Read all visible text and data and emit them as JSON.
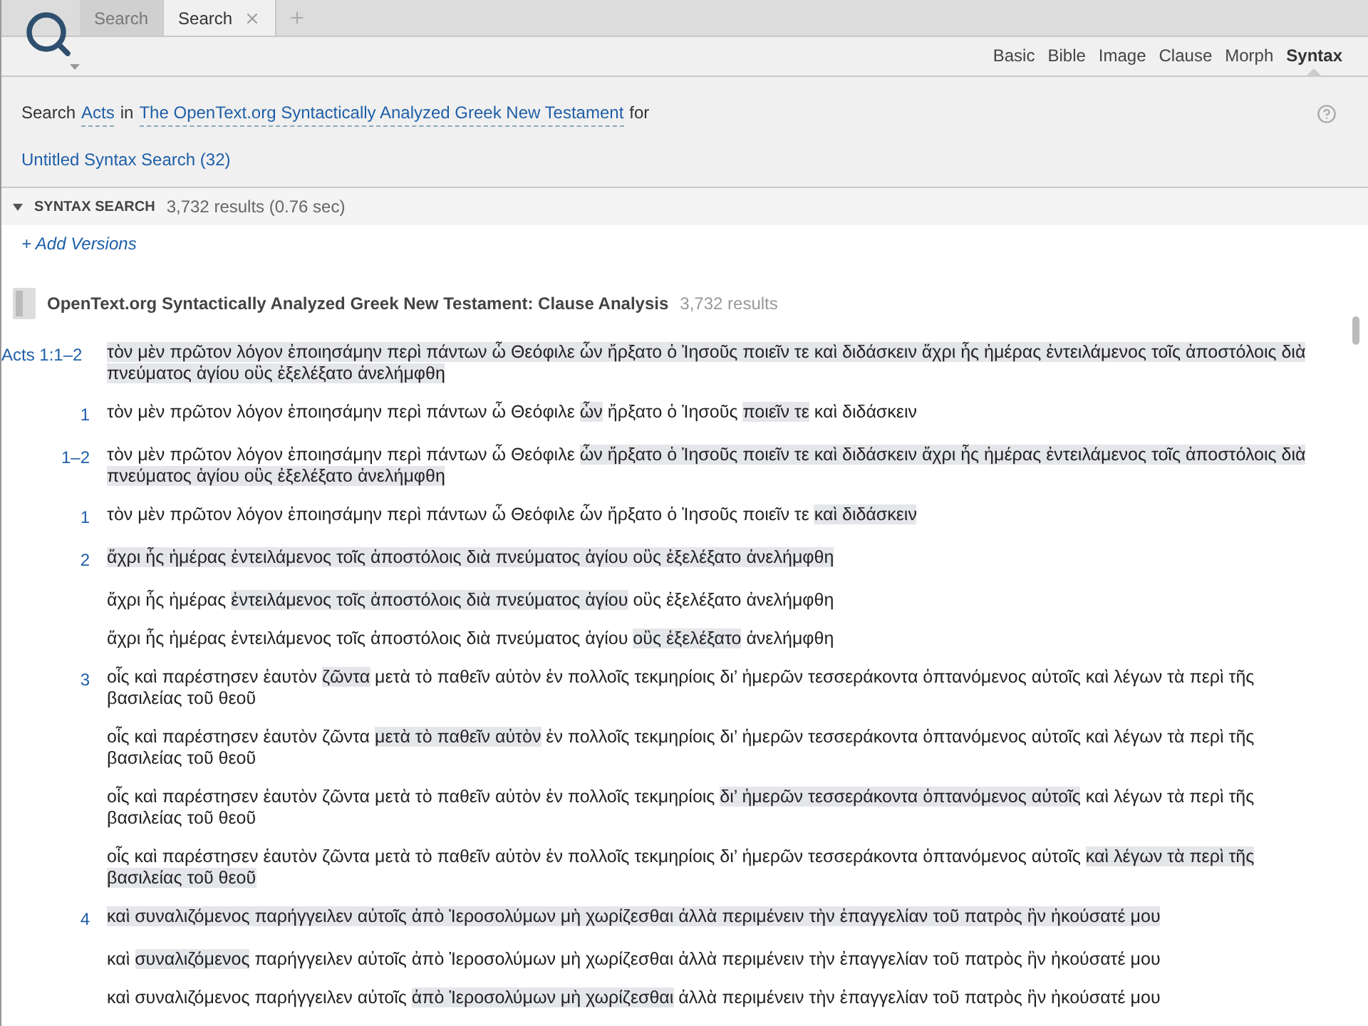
{
  "tabs": [
    {
      "label": "Search",
      "selected": false
    },
    {
      "label": "Search",
      "selected": true
    }
  ],
  "search_types": [
    {
      "label": "Basic",
      "selected": false
    },
    {
      "label": "Bible",
      "selected": false
    },
    {
      "label": "Image",
      "selected": false
    },
    {
      "label": "Clause",
      "selected": false
    },
    {
      "label": "Morph",
      "selected": false
    },
    {
      "label": "Syntax",
      "selected": true
    }
  ],
  "query": {
    "prefix": "Search",
    "range": "Acts",
    "connector": "in",
    "resource": "The OpenText.org Syntactically Analyzed Greek New Testament",
    "suffix": "for",
    "saved_search": "Untitled Syntax Search (32)"
  },
  "section": {
    "title": "SYNTAX SEARCH",
    "summary": "3,732 results (0.76 sec)",
    "expanded": true
  },
  "add_versions": "+ Add Versions",
  "results": {
    "title": "OpenText.org Syntactically Analyzed Greek New Testament: Clause Analysis",
    "count": "3,732 results",
    "rows": [
      {
        "label": "Acts 1:1–2",
        "kind": "reference",
        "segments": [
          {
            "text": "τὸν μὲν πρῶτον λόγον ἐποιησάμην περὶ πάντων ὦ Θεόφιλε ὧν ἤρξατο ὁ Ἰησοῦς ποιεῖν τε καὶ διδάσκειν ἄχρι ἧς ἡμέρας ἐντειλάμενος τοῖς ἀποστόλοις διὰ πνεύματος ἁγίου οὓς ἐξελέξατο ἀνελήμφθη",
            "highlighted": true
          }
        ]
      },
      {
        "label": "1",
        "kind": "number",
        "segments": [
          {
            "text": "τὸν μὲν πρῶτον λόγον ἐποιησάμην περὶ πάντων ὦ Θεόφιλε ",
            "highlighted": false
          },
          {
            "text": "ὧν",
            "highlighted": true
          },
          {
            "text": " ἤρξατο ὁ Ἰησοῦς ",
            "highlighted": false
          },
          {
            "text": "ποιεῖν τε",
            "highlighted": true
          },
          {
            "text": " καὶ διδάσκειν",
            "highlighted": false
          }
        ]
      },
      {
        "label": "1–2",
        "kind": "number",
        "segments": [
          {
            "text": "τὸν μὲν πρῶτον λόγον ἐποιησάμην περὶ πάντων ὦ Θεόφιλε ",
            "highlighted": false
          },
          {
            "text": "ὧν ἤρξατο ὁ Ἰησοῦς ποιεῖν τε καὶ διδάσκειν ἄχρι ἧς ἡμέρας ἐντειλάμενος τοῖς ἀποστόλοις διὰ πνεύματος ἁγίου οὓς ἐξελέξατο ἀνελήμφθη",
            "highlighted": true
          }
        ]
      },
      {
        "label": "1",
        "kind": "number",
        "segments": [
          {
            "text": "τὸν μὲν πρῶτον λόγον ἐποιησάμην περὶ πάντων ὦ Θεόφιλε ὧν ἤρξατο ὁ Ἰησοῦς ποιεῖν τε ",
            "highlighted": false
          },
          {
            "text": "καὶ διδάσκειν",
            "highlighted": true
          }
        ]
      },
      {
        "label": "2",
        "kind": "number",
        "segments": [
          {
            "text": "ἄχρι ἧς ἡμέρας ἐντειλάμενος τοῖς ἀποστόλοις διὰ πνεύματος ἁγίου οὓς ἐξελέξατο ἀνελήμφθη",
            "highlighted": true
          }
        ]
      },
      {
        "kind": "plain",
        "segments": [
          {
            "text": "ἄχρι ἧς ἡμέρας ",
            "highlighted": false
          },
          {
            "text": "ἐντειλάμενος τοῖς ἀποστόλοις διὰ πνεύματος ἁγίου",
            "highlighted": true
          },
          {
            "text": " οὓς ἐξελέξατο ἀνελήμφθη",
            "highlighted": false
          }
        ]
      },
      {
        "kind": "plain",
        "segments": [
          {
            "text": "ἄχρι ἧς ἡμέρας ἐντειλάμενος τοῖς ἀποστόλοις διὰ πνεύματος ἁγίου ",
            "highlighted": false
          },
          {
            "text": "οὓς ἐξελέξατο",
            "highlighted": true
          },
          {
            "text": " ἀνελήμφθη",
            "highlighted": false
          }
        ]
      },
      {
        "label": "3",
        "kind": "number",
        "segments": [
          {
            "text": "οἷς καὶ παρέστησεν ἑαυτὸν ",
            "highlighted": false
          },
          {
            "text": "ζῶντα",
            "highlighted": true
          },
          {
            "text": " μετὰ τὸ παθεῖν αὐτὸν ἐν πολλοῖς τεκμηρίοις δι’ ἡμερῶν τεσσεράκοντα ὀπτανόμενος αὐτοῖς καὶ λέγων τὰ περὶ τῆς βασιλείας τοῦ θεοῦ",
            "highlighted": false
          }
        ]
      },
      {
        "kind": "plain",
        "segments": [
          {
            "text": "οἷς καὶ παρέστησεν ἑαυτὸν ζῶντα ",
            "highlighted": false
          },
          {
            "text": "μετὰ τὸ παθεῖν αὐτὸν",
            "highlighted": true
          },
          {
            "text": " ἐν πολλοῖς τεκμηρίοις δι’ ἡμερῶν τεσσεράκοντα ὀπτανόμενος αὐτοῖς καὶ λέγων τὰ περὶ τῆς βασιλείας τοῦ θεοῦ",
            "highlighted": false
          }
        ]
      },
      {
        "kind": "plain",
        "segments": [
          {
            "text": "οἷς καὶ παρέστησεν ἑαυτὸν ζῶντα μετὰ τὸ παθεῖν αὐτὸν ἐν πολλοῖς τεκμηρίοις ",
            "highlighted": false
          },
          {
            "text": "δι’ ἡμερῶν τεσσεράκοντα ὀπτανόμενος αὐτοῖς",
            "highlighted": true
          },
          {
            "text": " καὶ λέγων τὰ περὶ τῆς βασιλείας τοῦ θεοῦ",
            "highlighted": false
          }
        ]
      },
      {
        "kind": "plain",
        "segments": [
          {
            "text": "οἷς καὶ παρέστησεν ἑαυτὸν ζῶντα μετὰ τὸ παθεῖν αὐτὸν ἐν πολλοῖς τεκμηρίοις δι’ ἡμερῶν τεσσεράκοντα ὀπτανόμενος αὐτοῖς ",
            "highlighted": false
          },
          {
            "text": "καὶ λέγων τὰ περὶ τῆς βασιλείας τοῦ θεοῦ",
            "highlighted": true
          }
        ]
      },
      {
        "label": "4",
        "kind": "number",
        "segments": [
          {
            "text": "καὶ συναλιζόμενος παρήγγειλεν αὐτοῖς ἀπὸ Ἱεροσολύμων μὴ χωρίζεσθαι ἀλλὰ περιμένειν τὴν ἐπαγγελίαν τοῦ πατρὸς ἣν ἠκούσατέ μου",
            "highlighted": true
          }
        ]
      },
      {
        "kind": "plain",
        "segments": [
          {
            "text": "καὶ ",
            "highlighted": false
          },
          {
            "text": "συναλιζόμενος",
            "highlighted": true
          },
          {
            "text": " παρήγγειλεν αὐτοῖς ἀπὸ Ἱεροσολύμων μὴ χωρίζεσθαι ἀλλὰ περιμένειν τὴν ἐπαγγελίαν τοῦ πατρὸς ἣν ἠκούσατέ μου",
            "highlighted": false
          }
        ]
      },
      {
        "kind": "plain",
        "segments": [
          {
            "text": "καὶ συναλιζόμενος παρήγγειλεν αὐτοῖς ",
            "highlighted": false
          },
          {
            "text": "ἀπὸ Ἱεροσολύμων μὴ χωρίζεσθαι",
            "highlighted": true
          },
          {
            "text": " ἀλλὰ περιμένειν τὴν ἐπαγγελίαν τοῦ πατρὸς ἣν ἠκούσατέ μου",
            "highlighted": false
          }
        ]
      }
    ]
  }
}
